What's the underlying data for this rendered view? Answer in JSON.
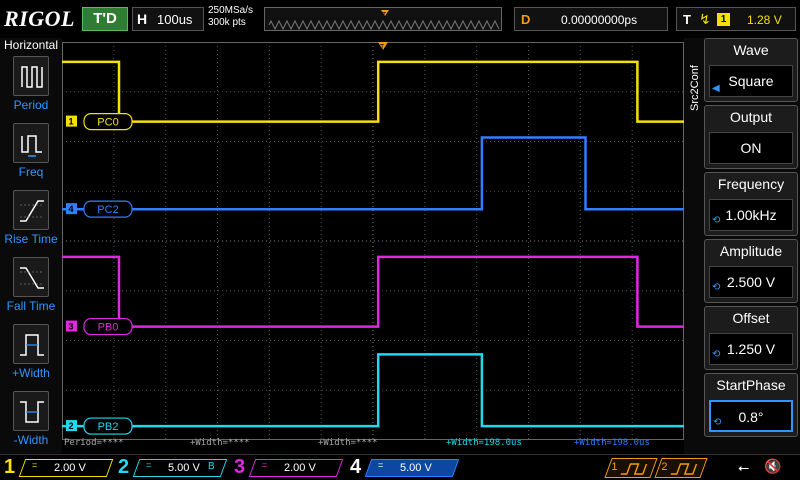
{
  "header": {
    "logo": "RIGOL",
    "trigger_status": "T'D",
    "horizontal": {
      "label": "H",
      "timebase": "100us"
    },
    "sample_rate": "250MSa/s",
    "memory_depth": "300k pts",
    "delay": {
      "label": "D",
      "value": "0.00000000ps"
    },
    "trigger": {
      "label": "T",
      "edge_icon": "rising-edge-icon",
      "edge_glyph": "↯",
      "source": "1",
      "level": "1.28 V"
    }
  },
  "left_menu": {
    "title": "Horizontal",
    "items": [
      {
        "label": "Period",
        "icon": "period-icon"
      },
      {
        "label": "Freq",
        "icon": "frequency-icon"
      },
      {
        "label": "Rise Time",
        "icon": "rise-time-icon"
      },
      {
        "label": "Fall Time",
        "icon": "fall-time-icon"
      },
      {
        "label": "+Width",
        "icon": "positive-width-icon"
      },
      {
        "label": "-Width",
        "icon": "negative-width-icon"
      }
    ]
  },
  "right_menu": {
    "title": "Src2Conf",
    "items": [
      {
        "label": "Wave",
        "value": "Square",
        "control": "arrow"
      },
      {
        "label": "Output",
        "value": "ON",
        "control": "none"
      },
      {
        "label": "Frequency",
        "value": "1.00kHz",
        "control": "knob"
      },
      {
        "label": "Amplitude",
        "value": "2.500 V",
        "control": "knob"
      },
      {
        "label": "Offset",
        "value": "1.250 V",
        "control": "knob"
      },
      {
        "label": "StartPhase",
        "value": "0.8°",
        "control": "knob",
        "selected": true
      }
    ]
  },
  "traces": [
    {
      "channel": "1",
      "label": "PC0",
      "color": "#f5e000",
      "high_level": 2,
      "low_level": 8
    },
    {
      "channel": "4",
      "label": "PC2",
      "color": "#2f7fff",
      "high_level": 9.6,
      "low_level": 16.8
    },
    {
      "channel": "3",
      "label": "PB0",
      "color": "#e028e0",
      "high_level": 21.6,
      "low_level": 28.6
    },
    {
      "channel": "2",
      "label": "PB2",
      "color": "#22d8f0",
      "high_level": 31.4,
      "low_level": 38.6
    }
  ],
  "measurements": [
    {
      "text": "Period=****",
      "color": "#aaaaaa"
    },
    {
      "text": "+Width=****",
      "color": "#aaaaaa"
    },
    {
      "text": "+Width=****",
      "color": "#aaaaaa"
    },
    {
      "text": "+Width=198.0us",
      "color": "#22d8f0"
    },
    {
      "text": "+Width=198.0us",
      "color": "#2f7fff"
    }
  ],
  "channels": [
    {
      "num": "1",
      "coupling": "=",
      "scale": "2.00 V",
      "color": "#f5e000",
      "bw": ""
    },
    {
      "num": "2",
      "coupling": "=",
      "scale": "5.00 V",
      "color": "#22d8f0",
      "bw": "B"
    },
    {
      "num": "3",
      "coupling": "=",
      "scale": "2.00 V",
      "color": "#e028e0",
      "bw": ""
    },
    {
      "num": "4",
      "coupling": "=",
      "scale": "5.00 V",
      "color": "#2f7fff",
      "bw": ""
    }
  ],
  "generators": [
    {
      "num": "1",
      "icon": "square-wave-icon"
    },
    {
      "num": "2",
      "icon": "square-wave-icon"
    }
  ],
  "status_icons": {
    "usb": "⭠",
    "usb_icon": "usb-icon",
    "mute": "🔇",
    "mute_icon": "speaker-mute-icon"
  },
  "trigger_marker": "T"
}
